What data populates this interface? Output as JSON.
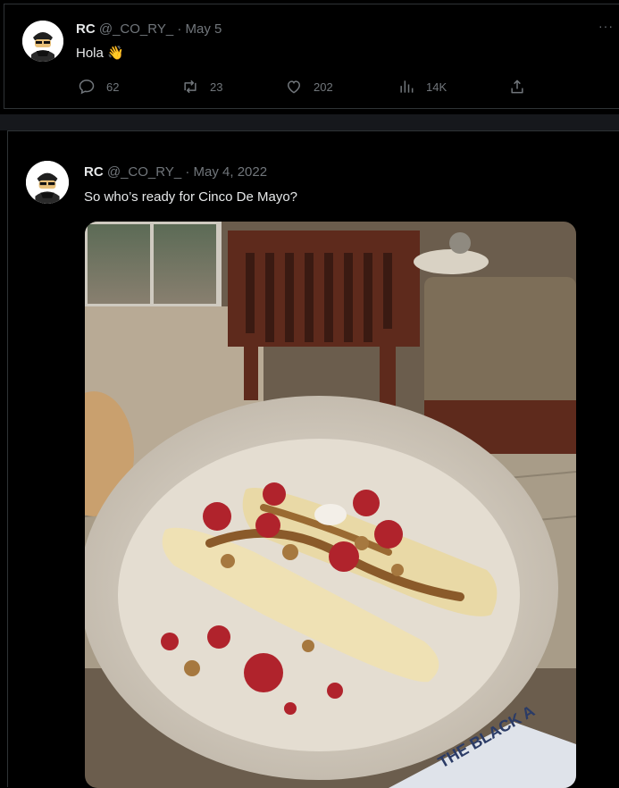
{
  "tweets": [
    {
      "name": "RC",
      "handle": "@_CO_RY_",
      "dot": "·",
      "date": "May 5",
      "text": "Hola 👋",
      "more_label": "···",
      "stats": {
        "replies": "62",
        "retweets": "23",
        "likes": "202",
        "views": "14K"
      }
    },
    {
      "name": "RC",
      "handle": "@_CO_RY_",
      "dot": "·",
      "date": "May 4, 2022",
      "text": "So who’s ready for Cinco De Mayo?",
      "photo_caption": "THE BLACK A"
    }
  ],
  "icons": [
    "reply-icon",
    "retweet-icon",
    "like-icon",
    "views-icon",
    "share-icon",
    "more-icon"
  ],
  "colors": {
    "background": "#000000",
    "text": "#e7e9ea",
    "muted": "#71767b",
    "divider": "#2f3336"
  }
}
